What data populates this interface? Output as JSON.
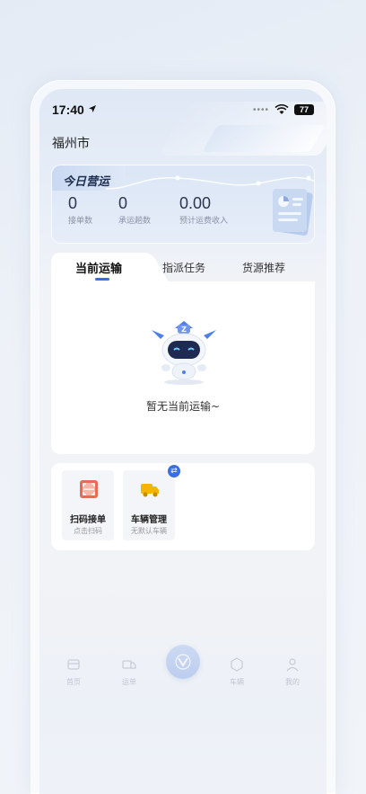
{
  "status_bar": {
    "time": "17:40",
    "battery": "77",
    "icons": [
      "location-arrow-icon",
      "signal-dots-icon",
      "wifi-icon",
      "battery-icon"
    ]
  },
  "city": "福州市",
  "operations": {
    "title": "今日营运",
    "stats": [
      {
        "value": "0",
        "label": "接单数"
      },
      {
        "value": "0",
        "label": "承运趟数"
      },
      {
        "value": "0.00",
        "label": "预计运费收入"
      }
    ]
  },
  "tabs": [
    {
      "label": "当前运输",
      "active": true
    },
    {
      "label": "指派任务",
      "active": false
    },
    {
      "label": "货源推荐",
      "active": false
    }
  ],
  "empty_state": {
    "text": "暂无当前运输~",
    "icon": "robot-mascot-icon"
  },
  "quick_actions": [
    {
      "label": "扫码接单",
      "sub": "点击扫码",
      "icon": "qr-scan-icon",
      "color": "#e8503c"
    },
    {
      "label": "车辆管理",
      "sub": "无默认车辆",
      "icon": "truck-icon",
      "color": "#f5b400"
    }
  ],
  "tabbar": {
    "items": [
      {
        "label": "首页",
        "icon": "home-icon"
      },
      {
        "label": "运单",
        "icon": "waybill-icon"
      },
      {
        "label": "",
        "icon": "center-logo-icon"
      },
      {
        "label": "车辆",
        "icon": "vehicle-icon"
      },
      {
        "label": "我的",
        "icon": "profile-icon"
      }
    ]
  },
  "colors": {
    "accent": "#3b6fe0",
    "background": "#f2f3f6"
  }
}
